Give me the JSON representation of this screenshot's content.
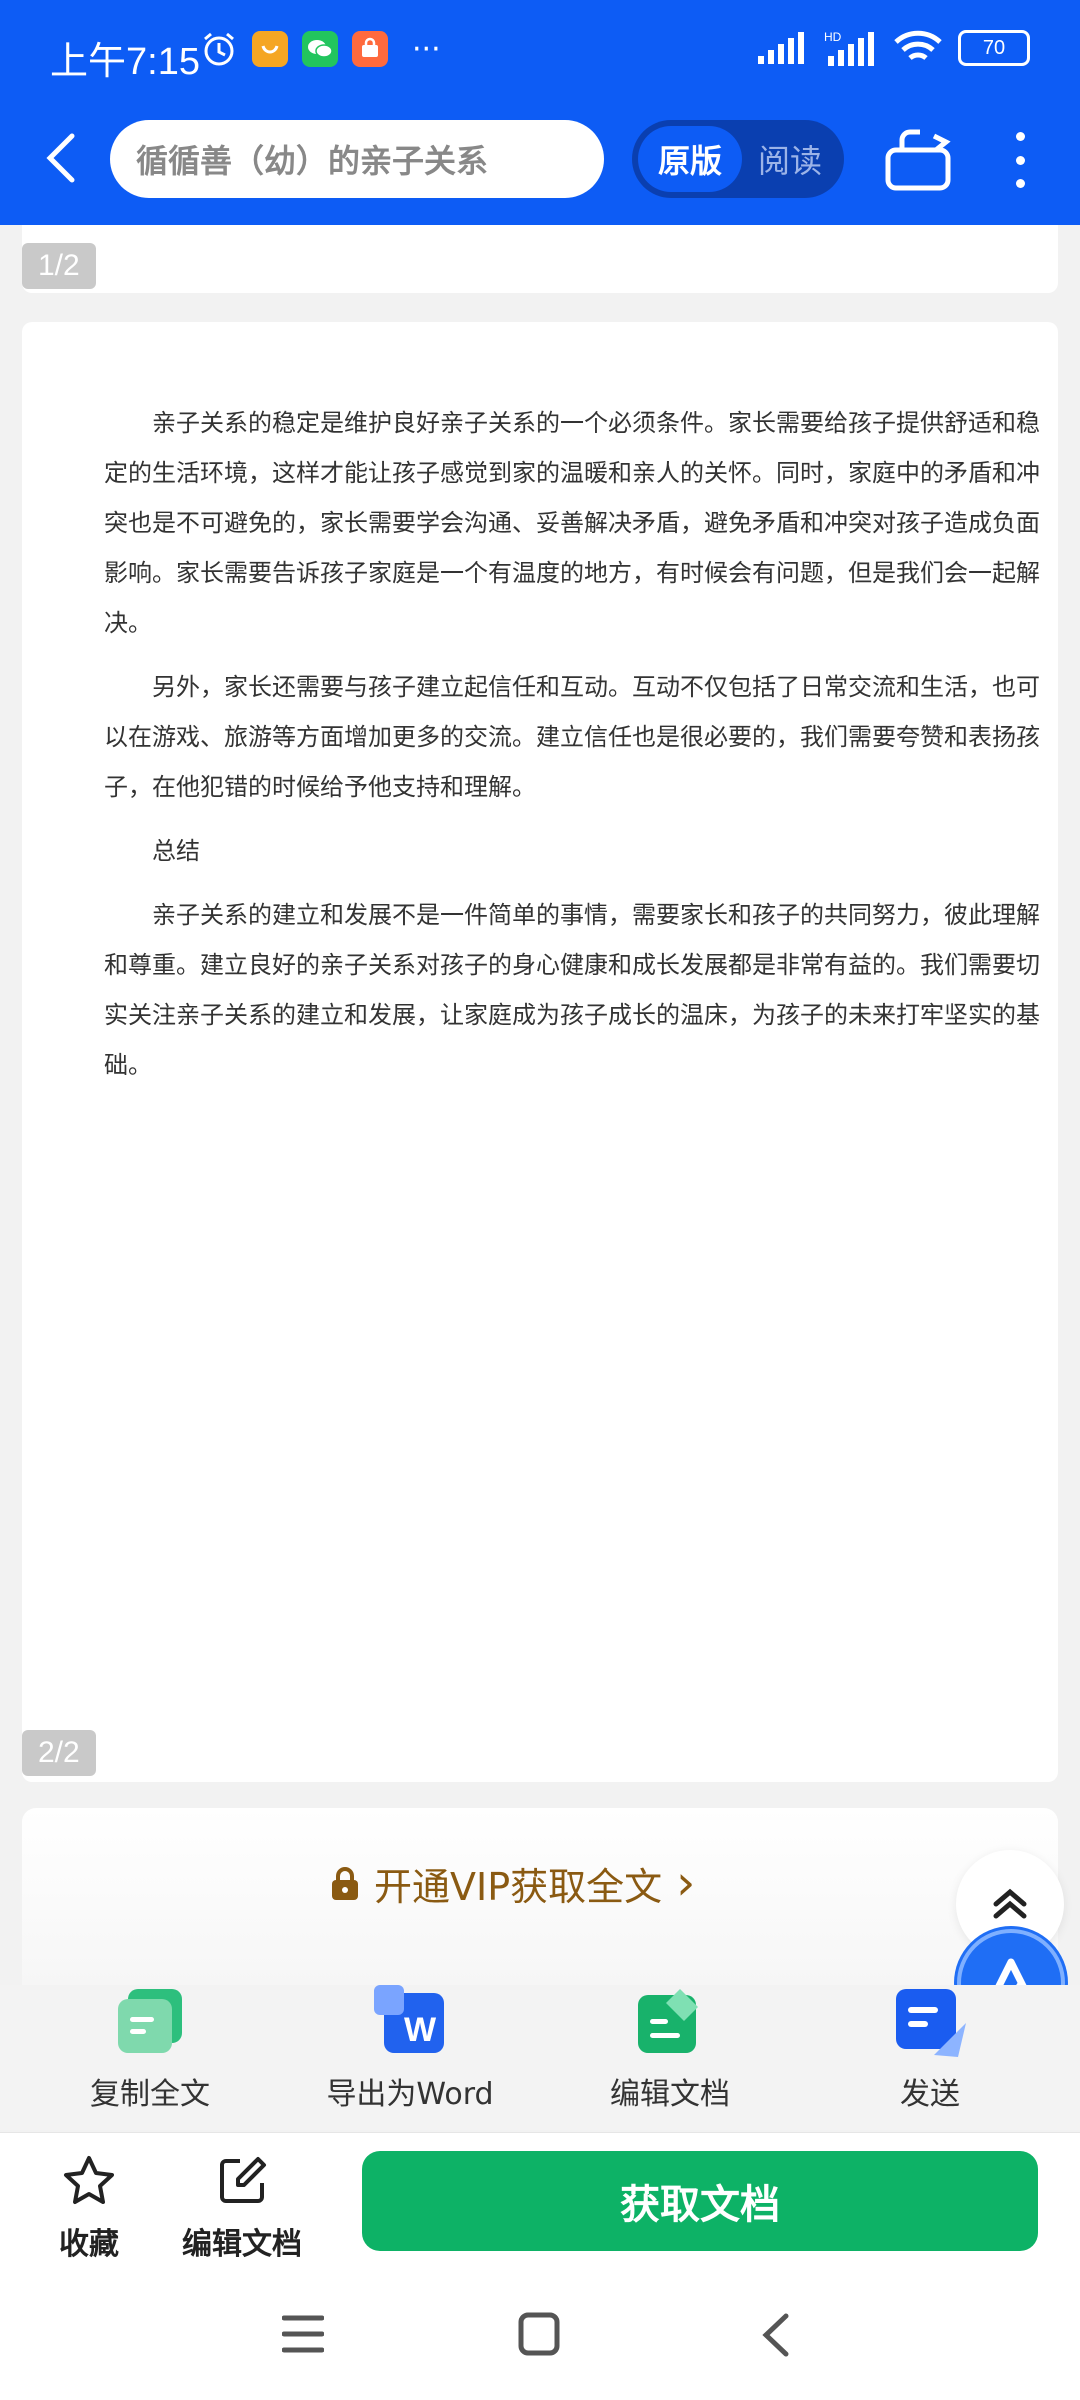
{
  "status_bar": {
    "time": "上午7:15",
    "more": "···",
    "network": "HD",
    "battery": "70"
  },
  "header": {
    "search_text": "循循善（幼）的亲子关系",
    "toggle_original": "原版",
    "toggle_reading": "阅读"
  },
  "document": {
    "page1_badge": "1/2",
    "page2_badge": "2/2",
    "paragraphs": [
      "亲子关系的稳定是维护良好亲子关系的一个必须条件。家长需要给孩子提供舒适和稳定的生活环境，这样才能让孩子感觉到家的温暖和亲人的关怀。同时，家庭中的矛盾和冲突也是不可避免的，家长需要学会沟通、妥善解决矛盾，避免矛盾和冲突对孩子造成负面影响。家长需要告诉孩子家庭是一个有温度的地方，有时候会有问题，但是我们会一起解决。",
      "另外，家长还需要与孩子建立起信任和互动。互动不仅包括了日常交流和生活，也可以在游戏、旅游等方面增加更多的交流。建立信任也是很必要的，我们需要夸赞和表扬孩子，在他犯错的时候给予他支持和理解。",
      "总结",
      "亲子关系的建立和发展不是一件简单的事情，需要家长和孩子的共同努力，彼此理解和尊重。建立良好的亲子关系对孩子的身心健康和成长发展都是非常有益的。我们需要切实关注亲子关系的建立和发展，让家庭成为孩子成长的温床，为孩子的未来打牢坚实的基础。"
    ]
  },
  "vip": {
    "label": "开通VIP获取全文",
    "arrow": "›"
  },
  "tools": [
    {
      "label": "复制全文",
      "icon": "copy-text-icon",
      "color": "#2dbf7d"
    },
    {
      "label": "导出为Word",
      "icon": "word-export-icon",
      "color": "#2162ee"
    },
    {
      "label": "编辑文档",
      "icon": "edit-doc-icon",
      "color": "#18b26b"
    },
    {
      "label": "发送",
      "icon": "send-icon",
      "color": "#1a5cf0"
    }
  ],
  "bottom_bar": {
    "favorite": "收藏",
    "edit": "编辑文档",
    "get_document": "获取文档"
  },
  "colors": {
    "header_blue": "#0d5cf5",
    "green_button": "#0db266",
    "vip_brown": "#8a5a12"
  }
}
